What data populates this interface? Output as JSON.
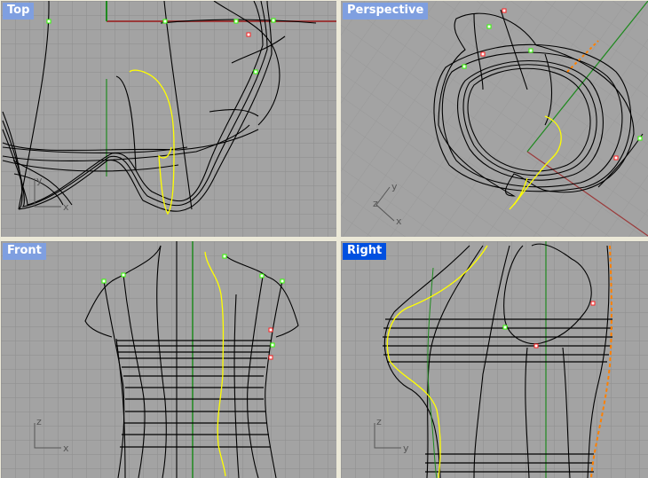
{
  "viewports": [
    {
      "id": "top",
      "label": "Top",
      "active": false,
      "axes": [
        "y",
        "x"
      ]
    },
    {
      "id": "perspective",
      "label": "Perspective",
      "active": false,
      "axes": [
        "y",
        "z",
        "x"
      ]
    },
    {
      "id": "front",
      "label": "Front",
      "active": false,
      "axes": [
        "z",
        "x"
      ]
    },
    {
      "id": "right",
      "label": "Right",
      "active": true,
      "axes": [
        "z",
        "y"
      ]
    }
  ],
  "colors": {
    "viewport_bg": "#a3a3a3",
    "grid": "#8e8e8e",
    "label_bg": "#7f9fe0",
    "active_label_bg": "#0050e0",
    "x_axis": "#9b3a3a",
    "y_axis": "#1f8a1f",
    "selected_curve": "#ffff00",
    "control_point": "#33ff00",
    "selected_point": "#ff2020",
    "edge_curve": "#ff8000"
  }
}
